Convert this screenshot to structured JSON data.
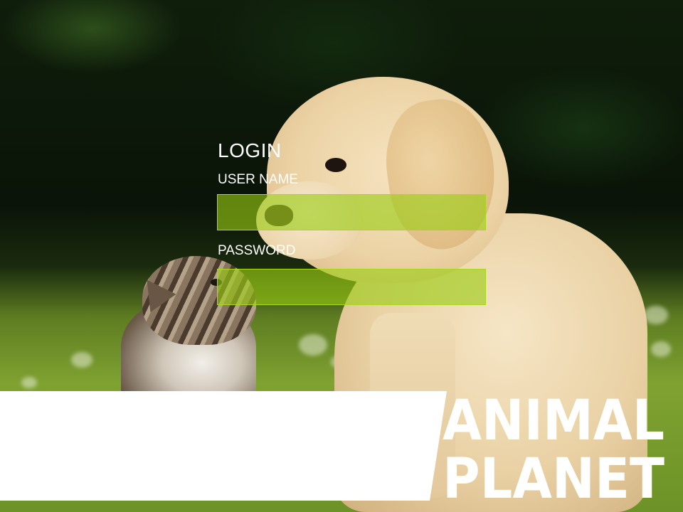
{
  "login": {
    "title": "LOGIN",
    "username_label": "USER NAME",
    "username_value": "",
    "password_label": "PASSWORD",
    "password_value": ""
  },
  "brand": {
    "logo_top": "ANIMAL",
    "logo_bottom": "PLANET",
    "logo_trademark": "™"
  },
  "colors": {
    "field_fill": "#9bcd14",
    "field_border": "#a8d820",
    "text": "#ffffff",
    "band": "#ffffff"
  }
}
